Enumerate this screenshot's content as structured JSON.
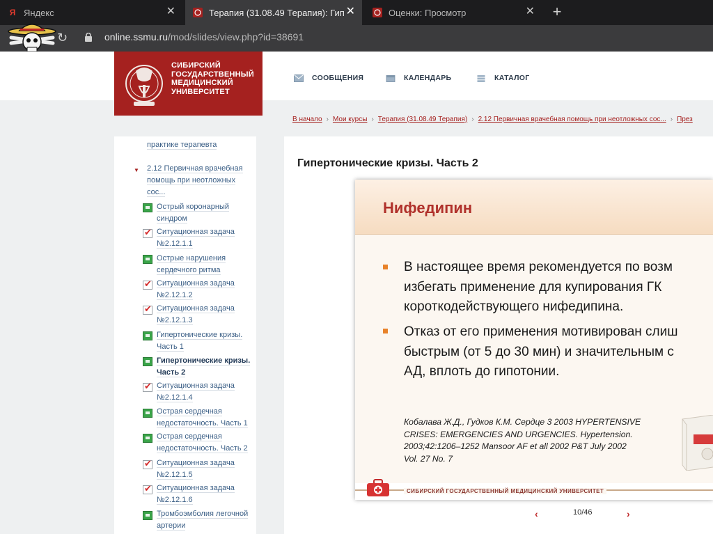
{
  "browser": {
    "tabs": [
      {
        "title": "Яндекс",
        "icon": "yandex-icon",
        "active": false
      },
      {
        "title": "Терапия (31.08.49 Терапия): Гип",
        "icon": "ssmu-crest-icon",
        "active": true
      },
      {
        "title": "Оценки: Просмотр",
        "icon": "ssmu-crest-icon",
        "active": false
      }
    ],
    "new_tab": "+",
    "url_host": "online.ssmu.ru",
    "url_path": "/mod/slides/view.php?id=38691"
  },
  "site": {
    "logo_lines": [
      "СИБИРСКИЙ",
      "ГОСУДАРСТВЕННЫЙ",
      "МЕДИЦИНСКИЙ",
      "УНИВЕРСИТЕТ"
    ],
    "nav": {
      "messages": "СООБЩЕНИЯ",
      "calendar": "КАЛЕНДАРЬ",
      "catalog": "КАТАЛОГ"
    },
    "breadcrumb": [
      "В начало",
      "Мои курсы",
      "Терапия (31.08.49 Терапия)",
      "2.12 Первичная врачебная помощь при неотложных сос...",
      "През"
    ]
  },
  "sidebar": {
    "items": [
      {
        "lines": [
          "практике терапевта"
        ],
        "type": "text"
      },
      {
        "lines": [
          "2.12 Первичная врачебная",
          "помощь при неотложных",
          "сос..."
        ],
        "type": "section"
      },
      {
        "lines": [
          "Острый коронарный",
          "синдром"
        ],
        "type": "slides"
      },
      {
        "lines": [
          "Ситуационная задача",
          "№2.12.1.1"
        ],
        "type": "task"
      },
      {
        "lines": [
          "Острые нарушения",
          "сердечного ритма"
        ],
        "type": "slides"
      },
      {
        "lines": [
          "Ситуационная задача",
          "№2.12.1.2"
        ],
        "type": "task"
      },
      {
        "lines": [
          "Ситуационная задача",
          "№2.12.1.3"
        ],
        "type": "task"
      },
      {
        "lines": [
          "Гипертонические кризы.",
          "Часть 1"
        ],
        "type": "slides"
      },
      {
        "lines": [
          "Гипертонические кризы.",
          "Часть 2"
        ],
        "type": "slides",
        "current": true
      },
      {
        "lines": [
          "Ситуационная задача",
          "№2.12.1.4"
        ],
        "type": "task"
      },
      {
        "lines": [
          "Острая сердечная",
          "недостаточность. Часть 1"
        ],
        "type": "slides"
      },
      {
        "lines": [
          "Острая сердечная",
          "недостаточность. Часть 2"
        ],
        "type": "slides"
      },
      {
        "lines": [
          "Ситуационная задача",
          "№2.12.1.5"
        ],
        "type": "task"
      },
      {
        "lines": [
          "Ситуационная задача",
          "№2.12.1.6"
        ],
        "type": "task"
      },
      {
        "lines": [
          "Тромбоэмболия легочной",
          "артерии"
        ],
        "type": "slides"
      }
    ]
  },
  "main": {
    "title": "Гипертонические кризы. Часть 2",
    "slide": {
      "heading": "Нифедипин",
      "bullets": [
        [
          "В настоящее время  рекомендуется по возм",
          "избегать применение для купирования ГК",
          "короткодействующего нифедипина."
        ],
        [
          "Отказ от его применения мотивирован слиш",
          "быстрым (от 5 до 30 мин) и значительным с",
          "АД, вплоть до гипотонии."
        ]
      ],
      "reference": [
        "Кобалава Ж.Д., Гудков К.М. Сердце 3 2003 HYPERTENSIVE",
        "CRISES: EMERGENCIES AND URGENCIES. Hypertension.",
        "2003;42:1206–1252  Mansoor AF et all 2002 P&T July 2002",
        "Vol. 27 No. 7"
      ],
      "footer": "СИБИРСКИЙ ГОСУДАРСТВЕННЫЙ МЕДИЦИНСКИЙ УНИВЕРСИТЕТ"
    },
    "pager": {
      "current": 10,
      "total": 46,
      "label": "10/46",
      "prev": "‹",
      "next": "›"
    }
  },
  "colors": {
    "brand_red": "#a5211f",
    "link_blue": "#3b5f86",
    "bullet_orange": "#e8822a"
  }
}
